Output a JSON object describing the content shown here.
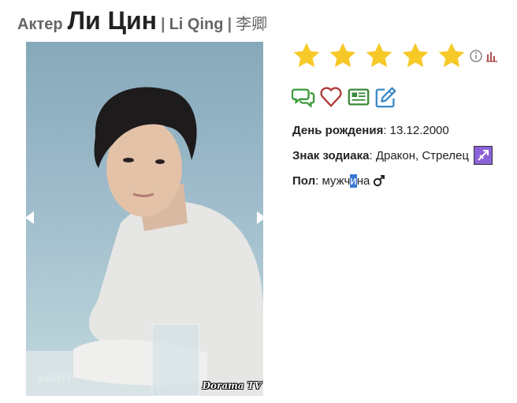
{
  "header": {
    "role": "Актер",
    "name": "Ли Цин",
    "separator": "|",
    "latin_name": "Li Qing",
    "native_name": "李卿"
  },
  "photo": {
    "alt": "Li Qing portrait",
    "watermark_left": "Bai百科",
    "watermark_right": "Dorama TV"
  },
  "rating": {
    "stars": 5,
    "max": 5,
    "star_color": "#f6c928"
  },
  "actions": [
    {
      "icon": "comments-icon",
      "color": "#3a9a3a"
    },
    {
      "icon": "heart-icon",
      "color": "#b03a3a"
    },
    {
      "icon": "news-icon",
      "color": "#3a8a3a"
    },
    {
      "icon": "edit-icon",
      "color": "#3a8ac8"
    }
  ],
  "details": {
    "birthday_label": "День рождения",
    "birthday_value": "13.12.2000",
    "zodiac_label": "Знак зодиака",
    "zodiac_value": "Дракон, Стрелец",
    "gender_label": "Пол",
    "gender_value_a": "мужч",
    "gender_value_sel": "и",
    "gender_value_b": "на",
    "colon": ":"
  }
}
